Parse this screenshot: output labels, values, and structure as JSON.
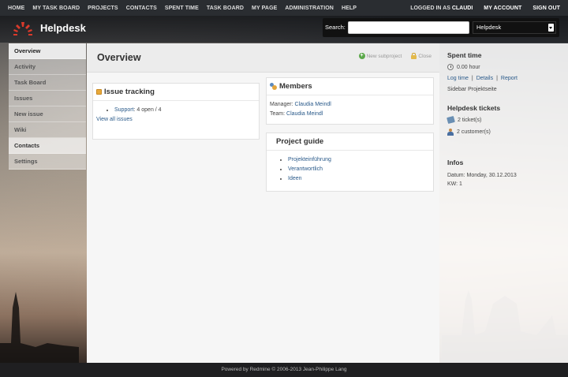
{
  "top_menu": {
    "items": [
      "HOME",
      "MY TASK BOARD",
      "PROJECTS",
      "CONTACTS",
      "SPENT TIME",
      "TASK BOARD",
      "MY PAGE",
      "ADMINISTRATION",
      "HELP"
    ],
    "logged_as_label": "LOGGED IN AS",
    "logged_as_user": "CLAUDI",
    "my_account": "MY ACCOUNT",
    "sign_out": "SIGN OUT"
  },
  "header": {
    "title": "Helpdesk",
    "search_label": "Search:",
    "search_value": "",
    "project_select": "Helpdesk"
  },
  "main_menu": {
    "items": [
      "Overview",
      "Activity",
      "Task Board",
      "Issues",
      "New issue",
      "Wiki",
      "Contacts",
      "Settings"
    ]
  },
  "content": {
    "title": "Overview",
    "new_subproject": "New subproject",
    "close": "Close",
    "issue_tracking": {
      "heading": "Issue tracking",
      "tracker_name": "Support",
      "tracker_counts": ": 4 open / 4",
      "view_all": "View all issues"
    },
    "members": {
      "heading": "Members",
      "manager_label": "Manager:",
      "manager_name": "Claudia Meindl",
      "team_label": "Team:",
      "team_name": "Claudia Meindl"
    },
    "project_guide": {
      "heading": "Project guide",
      "links": [
        "Projekteinführung",
        "Verantwortlich",
        "Ideen"
      ]
    }
  },
  "sidebar": {
    "spent_time_heading": "Spent time",
    "spent_hours": "0.00 hour",
    "log_time": "Log time",
    "details": "Details",
    "report": "Report",
    "sidebar_text": "Sidebar Projektseite",
    "helpdesk_heading": "Helpdesk tickets",
    "tickets": "2 ticket(s)",
    "customers": "2 customer(s)",
    "infos_heading": "Infos",
    "date_line": "Datum: Monday, 30.12.2013",
    "kw_line": "KW: 1"
  },
  "footer": {
    "text": "Powered by Redmine © 2006-2013 Jean-Philippe Lang"
  },
  "colors": {
    "link": "#2a5a8a",
    "top_bar": "#2a2d31",
    "logo_red": "#d93a2b"
  }
}
